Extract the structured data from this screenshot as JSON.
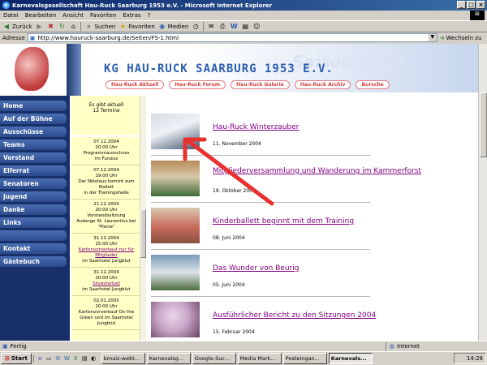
{
  "window": {
    "title": "Karnevalsgesellschaft Hau-Ruck Saarburg 1953 e.V. - Microsoft Internet Explorer"
  },
  "menu": [
    "Datei",
    "Bearbeiten",
    "Ansicht",
    "Favoriten",
    "Extras",
    "?"
  ],
  "toolbar": {
    "back": "Zurück",
    "search": "Suchen",
    "favorites": "Favoriten",
    "media": "Medien"
  },
  "address": {
    "label": "Adresse",
    "url": "http://www.hauruck-saarburg.de/Seiten/FS-1.html",
    "go": "Wechseln zu"
  },
  "site": {
    "title": "KG HAU-RUCK SAARBURG 1953 E.V.",
    "season": "Saison 2005",
    "nav": [
      "Hau-Ruck Aktuell",
      "Hau-Ruck Forum",
      "Hau-Ruck Galerie",
      "Hau-Ruck Archiv",
      "Bursche"
    ]
  },
  "sidebar": [
    "Home",
    "Auf der Bühne",
    "Ausschüsse",
    "Teams",
    "Vorstand",
    "Elferrat",
    "Senatoren",
    "Jugend",
    "Danke",
    "Links",
    "",
    "Kontakt",
    "Gästebuch"
  ],
  "events_header": [
    "Es gibt aktuell",
    "12 Termine"
  ],
  "events": [
    {
      "date": "07.12.2004",
      "time": "20:00 Uhr",
      "text": "Programmausschuss",
      "place": "im Fundus",
      "link": ""
    },
    {
      "date": "07.12.2004",
      "time": "19:00 Uhr",
      "text": "Der Nikolaus kommt zum Ballett",
      "place": "in der Trainingshalle",
      "link": ""
    },
    {
      "date": "21.12.2004",
      "time": "20:00 Uhr",
      "text": "Vorstandssitzung",
      "place": "Auberge St. Laurentius bei \"Pierre\"",
      "link": ""
    },
    {
      "date": "31.12.2004",
      "time": "15:00 Uhr",
      "text": "",
      "place": "im Saarhotel Jungblut",
      "link": "Kartenvorverkauf nur für Mitglieder"
    },
    {
      "date": "31.12.2004",
      "time": "20:00 Uhr",
      "text": "",
      "place": "im Saarhotel Jungblut",
      "link": "Silvesterball"
    },
    {
      "date": "02.01.2005",
      "time": "10:00 Uhr",
      "text": "Kartenvorverkauf On the Green und im Saarhotel Jungblut",
      "place": "",
      "link": ""
    }
  ],
  "news": [
    {
      "title": "Hau-Ruck Winterzauber",
      "date": "11. November 2004",
      "img_colors": [
        "#d8dde6",
        "#3d5570"
      ]
    },
    {
      "title": "Mitgliederversammlung und Wanderung im Kammerforst",
      "date": "19. Oktober 2004",
      "img_colors": [
        "#b88a5a",
        "#3e6d3a"
      ]
    },
    {
      "title": "Kinderballett beginnt mit dem Training",
      "date": "08. Juni 2004",
      "img_colors": [
        "#c86a5a",
        "#d9c8b0"
      ]
    },
    {
      "title": "Das Wunder von Beurig",
      "date": "05. Juni 2004",
      "img_colors": [
        "#7a9bb8",
        "#4d6d3e"
      ]
    },
    {
      "title": "Ausführlicher Bericht zu den Sitzungen 2004",
      "date": "15. Februar 2004",
      "img_colors": [
        "#c7a6c8",
        "#6a3f5e"
      ]
    }
  ],
  "status": {
    "left": "Fertig",
    "zone": "Internet"
  },
  "taskbar": {
    "start": "Start",
    "tasks": [
      "bmaiz-webt...",
      "Karnevalsg...",
      "Google-Suc...",
      "Media Mark...",
      "Posteingan...",
      "Karnevals..."
    ],
    "active_index": 5,
    "clock": "14:28"
  },
  "colors": {
    "sidebar": "#17306a",
    "events_bg": "#ffffc6",
    "link_visited": "#800080",
    "arrow": "#e8302f"
  }
}
